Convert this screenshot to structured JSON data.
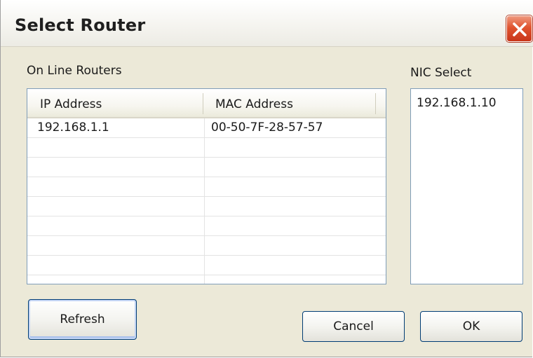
{
  "window": {
    "title": "Select Router",
    "close_icon": "close-icon"
  },
  "routers": {
    "label": "On Line Routers",
    "columns": [
      "IP Address",
      "MAC Address"
    ],
    "rows": [
      [
        "192.168.1.1",
        "00-50-7F-28-57-57"
      ],
      [
        "",
        ""
      ],
      [
        "",
        ""
      ],
      [
        "",
        ""
      ],
      [
        "",
        ""
      ],
      [
        "",
        ""
      ],
      [
        "",
        ""
      ],
      [
        "",
        ""
      ]
    ]
  },
  "nic": {
    "label": "NIC Select",
    "items": [
      "192.168.1.10"
    ]
  },
  "buttons": {
    "refresh": "Refresh",
    "cancel": "Cancel",
    "ok": "OK"
  },
  "colors": {
    "dialog_bg": "#ece9d8",
    "close_red": "#e0542f",
    "border_blue": "#7f9db9"
  }
}
